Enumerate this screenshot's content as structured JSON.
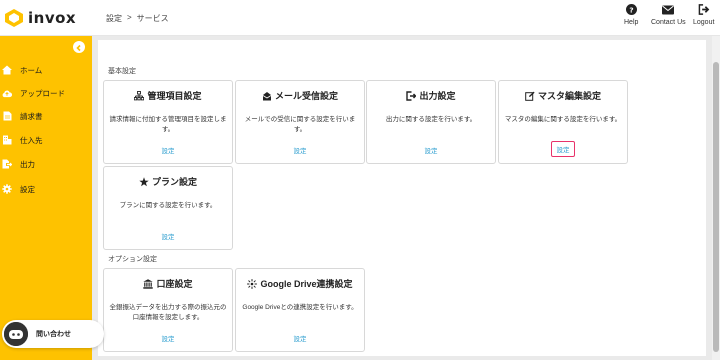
{
  "app": {
    "logo_text": "invox"
  },
  "breadcrumb": {
    "root": "設定",
    "sep": ">",
    "current": "サービス"
  },
  "header": {
    "help": "Help",
    "contact": "Contact Us",
    "logout": "Logout"
  },
  "sidebar": {
    "items": [
      {
        "label": "ホーム",
        "icon": "home-icon"
      },
      {
        "label": "アップロード",
        "icon": "cloud-upload-icon"
      },
      {
        "label": "請求書",
        "icon": "document-icon"
      },
      {
        "label": "仕入先",
        "icon": "building-icon"
      },
      {
        "label": "出力",
        "icon": "export-icon"
      },
      {
        "label": "設定",
        "icon": "gear-icon"
      }
    ],
    "contact_label": "問い合わせ"
  },
  "sections": {
    "basic": "基本設定",
    "option": "オプション設定"
  },
  "cards": [
    {
      "title": "管理項目設定",
      "icon": "sitemap-icon",
      "desc": "請求情報に付加する管理項目を設定します。",
      "link": "設定"
    },
    {
      "title": "メール受信設定",
      "icon": "mail-icon",
      "desc": "メールでの受信に関する設定を行います。",
      "link": "設定"
    },
    {
      "title": "出力設定",
      "icon": "export-icon",
      "desc": "出力に関する設定を行います。",
      "link": "設定"
    },
    {
      "title": "マスタ編集設定",
      "icon": "edit-icon",
      "desc": "マスタの編集に関する設定を行います。",
      "link": "設定"
    },
    {
      "title": "プラン設定",
      "icon": "star-icon",
      "desc": "プランに関する設定を行います。",
      "link": "設定"
    },
    {
      "title": "口座設定",
      "icon": "bank-icon",
      "desc": "全銀振込データを出力する際の振込元の口座情報を設定します。",
      "link": "設定"
    },
    {
      "title": "Google Drive連携設定",
      "icon": "sparkle-icon",
      "desc": "Google Driveとの連携設定を行います。",
      "link": "設定"
    }
  ],
  "colors": {
    "sidebar": "#fec200",
    "link": "#2f9fd0",
    "highlight": "#e8336a"
  }
}
